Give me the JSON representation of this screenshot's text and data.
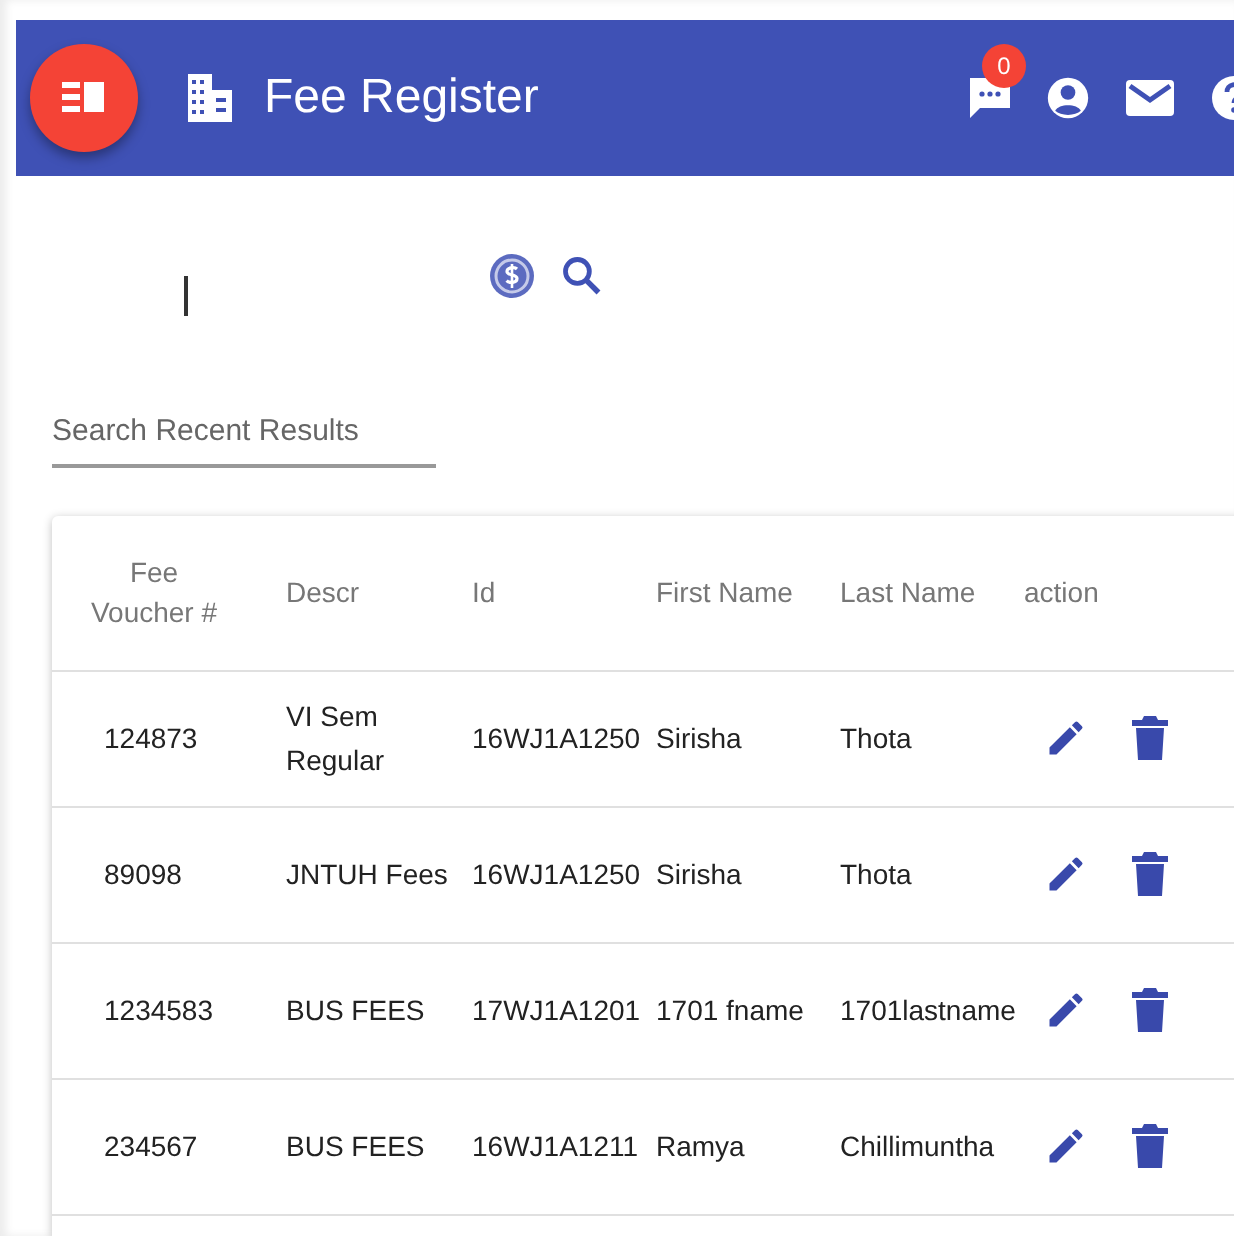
{
  "app_bar": {
    "title": "Fee Register",
    "notification_count": "0"
  },
  "search": {
    "placeholder": "Search Recent Results"
  },
  "table": {
    "columns": [
      "Fee Voucher #",
      "Descr",
      "Id",
      "First Name",
      "Last Name",
      "action"
    ],
    "rows": [
      {
        "cells": [
          "124873",
          "VI Sem Regular",
          "16WJ1A1250",
          "Sirisha",
          "Thota"
        ]
      },
      {
        "cells": [
          "89098",
          "JNTUH Fees",
          "16WJ1A1250",
          "Sirisha",
          "Thota"
        ]
      },
      {
        "cells": [
          "1234583",
          "BUS FEES",
          "17WJ1A1201",
          "1701 fname",
          "1701lastname"
        ]
      },
      {
        "cells": [
          "234567",
          "BUS FEES",
          "16WJ1A1211",
          "Ramya",
          "Chillimuntha"
        ]
      }
    ]
  }
}
